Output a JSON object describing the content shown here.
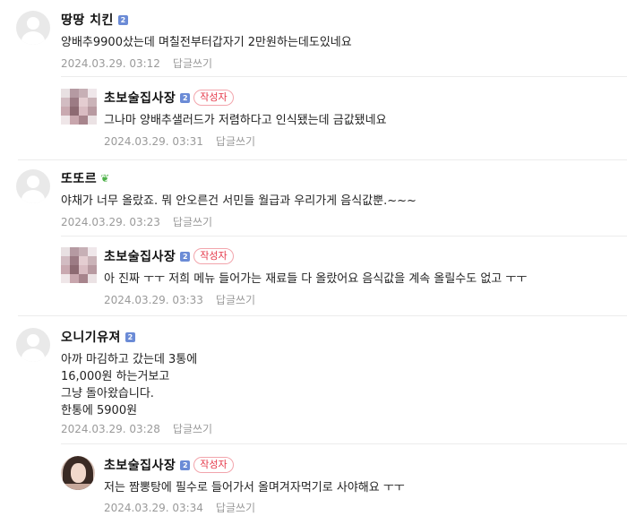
{
  "comments": [
    {
      "nickname": "땅땅 치킨",
      "level_icon": "2",
      "badge": "",
      "text_lines": [
        "양배추9900샀는데 며칠전부터갑자기 2만원하는데도있네요"
      ],
      "date": "2024.03.29. 03:12",
      "reply_label": "답글쓰기",
      "is_reply": false,
      "avatar": "default-avatar"
    },
    {
      "nickname": "초보술집사장",
      "level_icon": "2",
      "badge": "작성자",
      "text_lines": [
        "그나마 양배추샐러드가 저렴하다고 인식됐는데 금값됐네요"
      ],
      "date": "2024.03.29. 03:31",
      "reply_label": "답글쓰기",
      "is_reply": true,
      "avatar": "pixelated-avatar"
    },
    {
      "nickname": "또또르",
      "level_icon": "sprout-icon",
      "badge": "",
      "text_lines": [
        "야채가 너무 올랐죠. 뭐 안오른건 서민들 월급과 우리가게 음식값뿐.~~~"
      ],
      "date": "2024.03.29. 03:23",
      "reply_label": "답글쓰기",
      "is_reply": false,
      "avatar": "default-avatar"
    },
    {
      "nickname": "초보술집사장",
      "level_icon": "2",
      "badge": "작성자",
      "text_lines": [
        "아 진짜 ㅜㅜ 저희 메뉴 들어가는 재료들 다 올랐어요 음식값을 계속 올릴수도 없고 ㅜㅜ"
      ],
      "date": "2024.03.29. 03:33",
      "reply_label": "답글쓰기",
      "is_reply": true,
      "avatar": "pixelated-avatar"
    },
    {
      "nickname": "오니기유져",
      "level_icon": "2",
      "badge": "",
      "text_lines": [
        "아까 마김하고 갔는데 3통에",
        "16,000원 하는거보고",
        "그냥 돌아왔습니다.",
        "한통에 5900원"
      ],
      "date": "2024.03.29. 03:28",
      "reply_label": "답글쓰기",
      "is_reply": false,
      "avatar": "default-avatar"
    },
    {
      "nickname": "초보술집사장",
      "level_icon": "2",
      "badge": "작성자",
      "text_lines": [
        "저는 짬뽕탕에 필수로 들어가서 올며겨자먹기로 사야해요 ㅜㅜ"
      ],
      "date": "2024.03.29. 03:34",
      "reply_label": "답글쓰기",
      "is_reply": true,
      "avatar": "photo-avatar"
    }
  ],
  "colors": {
    "badge_text": "#e5394a",
    "badge_border": "#f2a5ac",
    "level_icon": "#6b8bd6",
    "sprout": "#4fb24a",
    "meta_text": "#9a9a9a"
  }
}
